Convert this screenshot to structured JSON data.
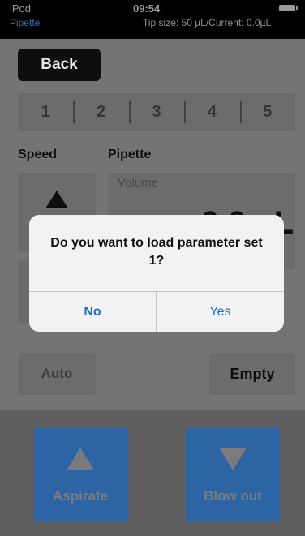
{
  "status_bar": {
    "carrier": "iPod",
    "time": "09:54",
    "app_name": "Pipette",
    "tip_info": "Tip size:   50 µL/Current:    0.0µL"
  },
  "toolbar": {
    "back_label": "Back"
  },
  "parameter_sets": [
    "1",
    "2",
    "3",
    "4",
    "5"
  ],
  "speed": {
    "label": "Speed"
  },
  "pipette": {
    "label": "Pipette",
    "volume_label": "Volume",
    "volume_value": "0.0 µL"
  },
  "controls": {
    "auto_label": "Auto",
    "empty_label": "Empty"
  },
  "actions": {
    "aspirate_label": "Aspirate",
    "blowout_label": "Blow out"
  },
  "dialog": {
    "message": "Do you want to load parameter set 1?",
    "no_label": "No",
    "yes_label": "Yes"
  },
  "colors": {
    "dialog_button": "#1a6ed1",
    "action_button": "#2c64a4",
    "dimmed_background": "#747474"
  }
}
